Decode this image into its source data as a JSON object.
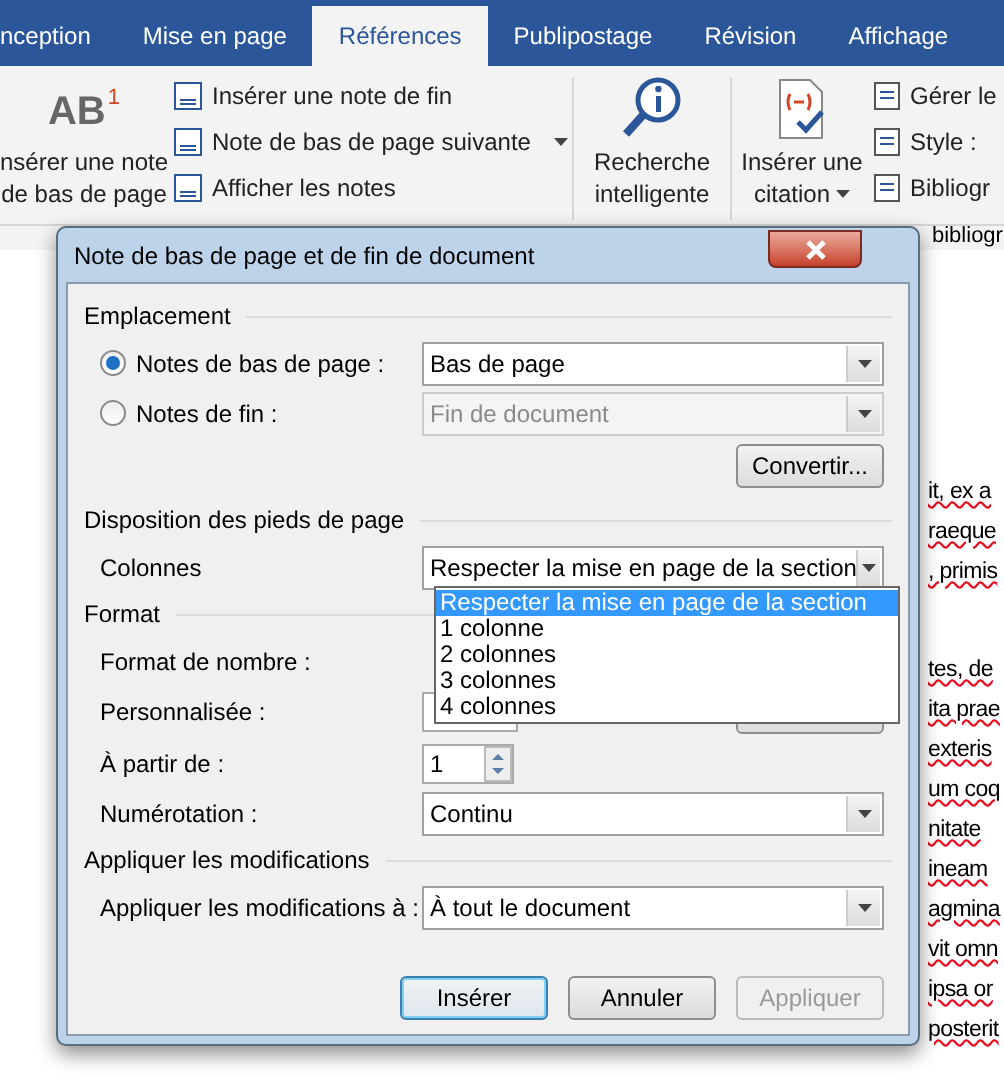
{
  "ribbon": {
    "tabs": [
      {
        "label": "nception",
        "selected": false
      },
      {
        "label": "Mise en page",
        "selected": false
      },
      {
        "label": "Références",
        "selected": true
      },
      {
        "label": "Publipostage",
        "selected": false
      },
      {
        "label": "Révision",
        "selected": false
      },
      {
        "label": "Affichage",
        "selected": false
      }
    ],
    "footnote_button": {
      "badge": "1",
      "icon_text": "AB",
      "lines": [
        "nsérer une note",
        "de bas de page"
      ]
    },
    "footnote_commands": [
      {
        "label": "Insérer une note de fin",
        "has_menu": false
      },
      {
        "label": "Note de bas de page suivante",
        "has_menu": true
      },
      {
        "label": "Afficher les notes",
        "has_menu": false
      }
    ],
    "smart_lookup": {
      "lines": [
        "Recherche",
        "intelligente"
      ]
    },
    "citation_button": {
      "lines": [
        "Insérer une",
        "citation"
      ]
    },
    "citation_commands": [
      "Gérer le",
      "Style :",
      "Bibliogr"
    ],
    "group_label": "bibliogr"
  },
  "dialog": {
    "title": "Note de bas de page et de fin de document",
    "location": {
      "heading": "Emplacement",
      "options": [
        {
          "label": "Notes de bas de page :",
          "selected": true,
          "value": "Bas de page"
        },
        {
          "label": "Notes de fin :",
          "selected": false,
          "value": "Fin de document"
        }
      ],
      "convert_button": "Convertir..."
    },
    "layout": {
      "heading": "Disposition des pieds de page",
      "columns_label": "Colonnes",
      "columns_value": "Respecter la mise en page de la section",
      "dropdown_options": [
        {
          "label": "Respecter la mise en page de la section",
          "selected": true
        },
        {
          "label": "1 colonne",
          "selected": false
        },
        {
          "label": "2 colonnes",
          "selected": false
        },
        {
          "label": "3 colonnes",
          "selected": false
        },
        {
          "label": "4 colonnes",
          "selected": false
        }
      ]
    },
    "format": {
      "heading": "Format",
      "number_format_label": "Format de nombre :",
      "custom_label": "Personnalisée :",
      "start_label": "À partir de :",
      "start_value": "1",
      "numbering_label": "Numérotation :",
      "numbering_value": "Continu"
    },
    "apply": {
      "heading": "Appliquer les modifications",
      "label": "Appliquer les modifications à :",
      "value": "À tout le document"
    },
    "buttons": [
      {
        "label": "Insérer",
        "default": true,
        "disabled": false
      },
      {
        "label": "Annuler",
        "default": false,
        "disabled": false
      },
      {
        "label": "Appliquer",
        "default": false,
        "disabled": true
      }
    ]
  },
  "document": {
    "paragraphs": [
      [
        "it, ex a",
        "raeque",
        ", primis"
      ],
      [
        "tes, de",
        "ita prae",
        "exteris",
        "um coq",
        "nitate",
        "ineam",
        "agmina",
        "vit omn",
        "ipsa or",
        "posterit"
      ]
    ]
  }
}
